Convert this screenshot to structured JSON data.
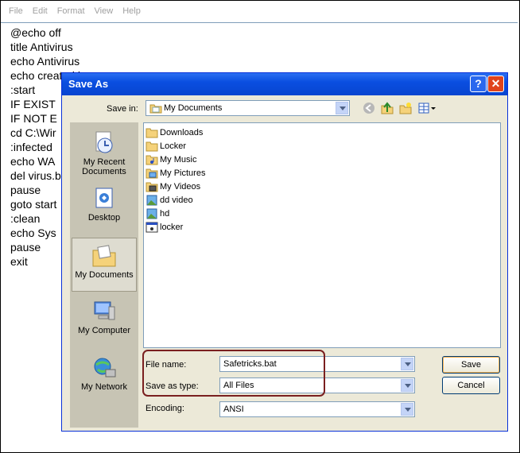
{
  "notepad": {
    "menu": [
      "File",
      "Edit",
      "Format",
      "View",
      "Help"
    ],
    "lines": [
      "@echo off",
      "title Antivirus",
      "echo Antivirus",
      "echo created b",
      ":start",
      "IF EXIST",
      "IF NOT E",
      "cd C:\\Wir",
      ":infected",
      "echo WA",
      "del virus.b",
      "pause",
      "goto start",
      ":clean",
      "echo Sys",
      "pause",
      "exit"
    ]
  },
  "dialog": {
    "title": "Save As",
    "help_glyph": "?",
    "close_glyph": "✕",
    "save_in_label": "Save in:",
    "save_in_value": "My Documents",
    "places": [
      "My Recent Documents",
      "Desktop",
      "My Documents",
      "My Computer",
      "My Network"
    ],
    "files": [
      {
        "name": "Downloads",
        "icon": "folder-icon"
      },
      {
        "name": "Locker",
        "icon": "folder-icon"
      },
      {
        "name": "My Music",
        "icon": "music-folder-icon"
      },
      {
        "name": "My Pictures",
        "icon": "pictures-folder-icon"
      },
      {
        "name": "My Videos",
        "icon": "videos-folder-icon"
      },
      {
        "name": "dd video",
        "icon": "image-file-icon"
      },
      {
        "name": "hd",
        "icon": "image-file-icon"
      },
      {
        "name": "locker",
        "icon": "exe-file-icon"
      }
    ],
    "file_name_label": "File name:",
    "file_name_value": "Safetricks.bat",
    "save_type_label": "Save as type:",
    "save_type_value": "All Files",
    "encoding_label": "Encoding:",
    "encoding_value": "ANSI",
    "save_button": "Save",
    "cancel_button": "Cancel"
  },
  "colors": {
    "title_bar": "#0a4ee0",
    "highlight_outline": "#7a1f1f",
    "dialog_bg": "#ece9d8"
  }
}
